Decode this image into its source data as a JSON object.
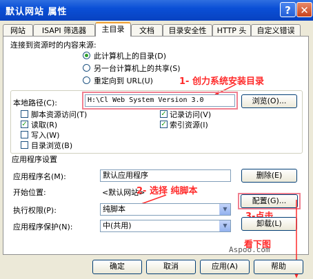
{
  "window": {
    "title": "默认网站 属性",
    "help_glyph": "?",
    "close_glyph": "✕"
  },
  "tabs": [
    "网站",
    "ISAPI 筛选器",
    "主目录",
    "文档",
    "目录安全性",
    "HTTP 头",
    "自定义错误"
  ],
  "active_tab": "主目录",
  "source": {
    "prompt": "连接到资源时的内容来源:",
    "options": [
      "此计算机上的目录(D)",
      "另一台计算机上的共享(S)",
      "重定向到 URL(U)"
    ],
    "selected_index": 0
  },
  "local_path": {
    "label": "本地路径(C):",
    "value": "H:\\Cl Web System Version 3.0",
    "browse_button": "浏览(O)..."
  },
  "permissions": {
    "script_source": {
      "label": "脚本资源访问(T)",
      "checked": false
    },
    "log_visits": {
      "label": "记录访问(V)",
      "checked": true
    },
    "read": {
      "label": "读取(R)",
      "checked": true
    },
    "index_resource": {
      "label": "索引资源(I)",
      "checked": true
    },
    "write": {
      "label": "写入(W)",
      "checked": false
    },
    "directory_browse": {
      "label": "目录浏览(B)",
      "checked": false
    },
    "check_glyph": "✓"
  },
  "app_settings": {
    "group_title": "应用程序设置",
    "app_name_label": "应用程序名(M):",
    "app_name_value": "默认应用程序",
    "delete_button": "删除(E)",
    "start_label": "开始位置:",
    "start_value": "<默认网站>",
    "config_button": "配置(G)...",
    "exec_perm_label": "执行权限(P):",
    "exec_perm_value": "纯脚本",
    "unload_button": "卸载(L)",
    "protection_label": "应用程序保护(N):",
    "protection_value": "中(共用)",
    "dropdown_glyph": "▼"
  },
  "annotations": {
    "step1": "1- 创力系统安装目录",
    "step2": "2- 选择 纯脚本",
    "step3": "3-点击",
    "see_below": "看下图",
    "watermark": "Aspoo.com"
  },
  "footer": {
    "ok": "确定",
    "cancel": "取消",
    "apply": "应用(A)",
    "help": "帮助"
  },
  "colors": {
    "title_bar": "#0a4fd6",
    "dialog_bg": "#ece9d8",
    "annotation": "#ff2a2a",
    "highlight_box": "#f08090"
  }
}
